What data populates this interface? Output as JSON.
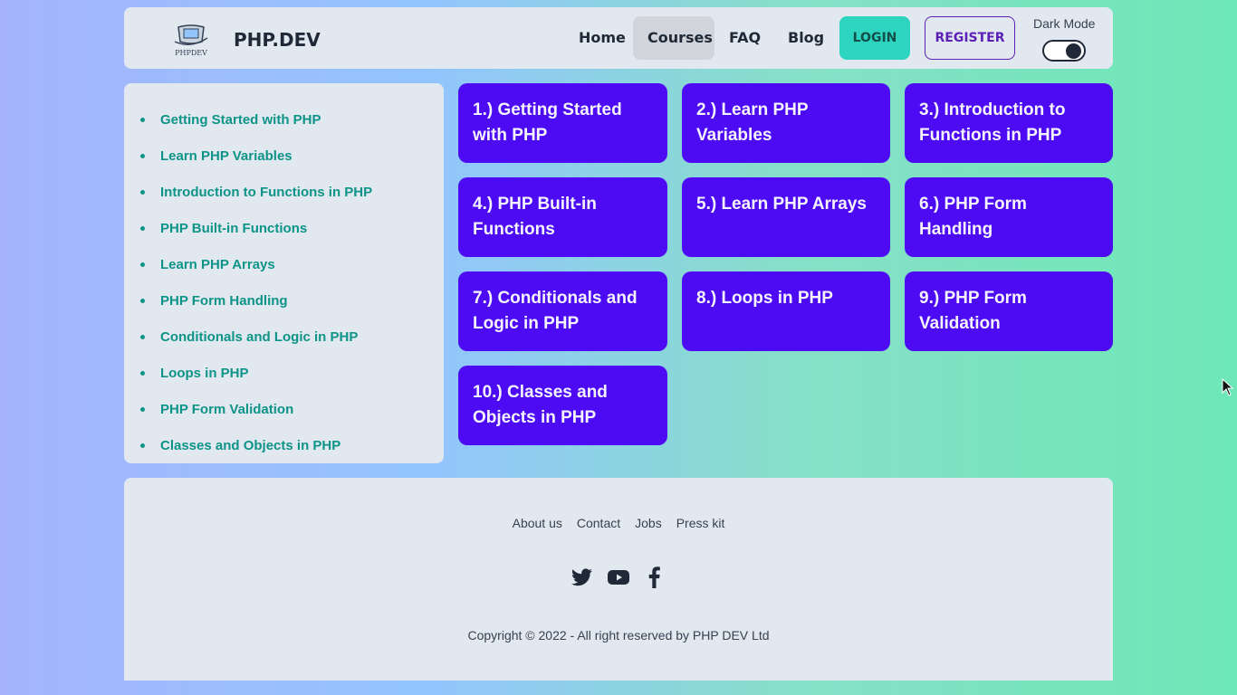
{
  "nav": {
    "brand": "PHP.DEV",
    "logo_text": "PHPDEV",
    "links": [
      "Home",
      "Courses",
      "FAQ",
      "Blog"
    ],
    "active_link": "Courses",
    "login_label": "LOGIN",
    "register_label": "REGISTER",
    "dark_mode_label": "Dark Mode",
    "dark_mode_on": true
  },
  "sidebar": {
    "items": [
      "Getting Started with PHP",
      "Learn PHP Variables",
      "Introduction to Functions in PHP",
      "PHP Built-in Functions",
      "Learn PHP Arrays",
      "PHP Form Handling",
      "Conditionals and Logic in PHP",
      "Loops in PHP",
      "PHP Form Validation",
      "Classes and Objects in PHP"
    ]
  },
  "cards": [
    "1.) Getting Started with PHP",
    "2.) Learn PHP Variables",
    "3.) Introduction to Functions in PHP",
    "4.) PHP Built-in Functions",
    "5.) Learn PHP Arrays",
    "6.) PHP Form Handling",
    "7.) Conditionals and Logic in PHP",
    "8.) Loops in PHP",
    "9.) PHP Form Validation",
    "10.) Classes and Objects in PHP"
  ],
  "footer": {
    "links": [
      "About us",
      "Contact",
      "Jobs",
      "Press kit"
    ],
    "socials": [
      "twitter-icon",
      "youtube-icon",
      "facebook-icon"
    ],
    "copyright": "Copyright © 2022 - All right reserved by PHP DEV Ltd"
  },
  "colors": {
    "card_bg": "#4c0bf2",
    "accent_teal": "#0d9488",
    "login_bg": "#2dd4bf",
    "panel_bg": "#e2e8f0"
  }
}
